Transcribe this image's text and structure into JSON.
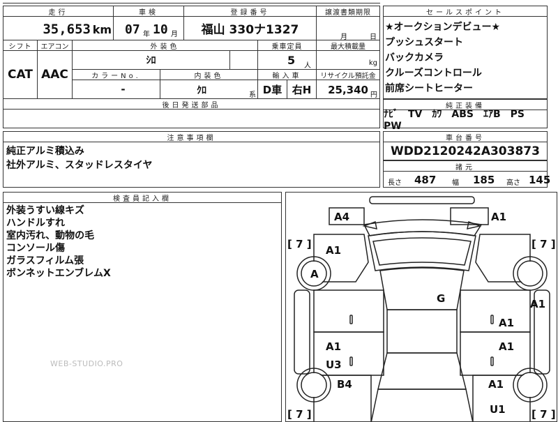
{
  "headers": {
    "mileage": "走行",
    "inspection": "車検",
    "registration": "登録番号",
    "transfer_deadline": "譲渡書類期限",
    "sales_points": "セールスポイント",
    "shift": "シフト",
    "aircon": "エアコン",
    "exterior_color": "外装色",
    "capacity": "乗車定員",
    "max_load": "最大積載量",
    "color_no": "カラーNo.",
    "interior_color": "内装色",
    "import": "輸入車",
    "recycle": "リサイクル預託金",
    "later_parts": "後日発送部品",
    "genuine_equip": "純正装備",
    "notes": "注意事項欄",
    "chassis_no": "車台番号",
    "dimensions": "諸元",
    "inspector": "検査員記入欄"
  },
  "vehicle": {
    "mileage": "35,653",
    "mileage_unit": "km",
    "inspection_year": "07",
    "year_unit": "年",
    "inspection_month": "10",
    "month_unit": "月",
    "registration": "福山 330ナ1327",
    "deadline_month": "月",
    "deadline_day": "日",
    "shift": "CAT",
    "aircon": "AAC",
    "exterior_color": "ｼﾛ",
    "capacity": "5",
    "capacity_unit": "人",
    "load_unit": "kg",
    "color_no": "-",
    "interior_color": "ｸﾛ",
    "interior_suffix": "系",
    "import_type": "D車",
    "steering": "右H",
    "recycle_fee": "25,340",
    "recycle_unit": "円",
    "chassis_no": "WDD2120242A303873"
  },
  "sales_points": [
    "★オークションデビュー★",
    "プッシュスタート",
    "バックカメラ",
    "クルーズコントロール",
    "前席シートヒーター"
  ],
  "genuine_equipment": "ﾅﾋﾞ　TV　ｶﾜ　ABS　ｴｱB　PS　PW",
  "notes": [
    "純正アルミ積込み",
    "社外アルミ、スタッドレスタイヤ"
  ],
  "dimensions": {
    "length_label": "長さ",
    "length": "487",
    "width_label": "幅",
    "width": "185",
    "height_label": "高さ",
    "height": "145"
  },
  "inspector_notes": [
    "外装うすい線キズ",
    "ハンドルすれ",
    "室内汚れ、動物の毛",
    "コンソール傷",
    "ガラスフィルム張",
    "ボンネットエンブレムX"
  ],
  "watermark": "WEB-STUDIO.PRO",
  "diagram": {
    "tread_fl": "[ 7 ]",
    "tread_fr": "[ 7 ]",
    "tread_rl": "[ 7 ]",
    "tread_rr": "[ 7 ]",
    "marks": {
      "front_left_corner": "A4",
      "front_right_corner": "A1",
      "left_fender": "A1",
      "front_left_wheel": "A",
      "roof": "G",
      "right_fender": "A1",
      "right_front_door": "A1",
      "left_rear_door": "A1",
      "left_rear_door_2": "U3",
      "right_rear_door": "A1",
      "left_quarter": "B4",
      "right_quarter": "A1",
      "rear_right": "U1"
    }
  }
}
